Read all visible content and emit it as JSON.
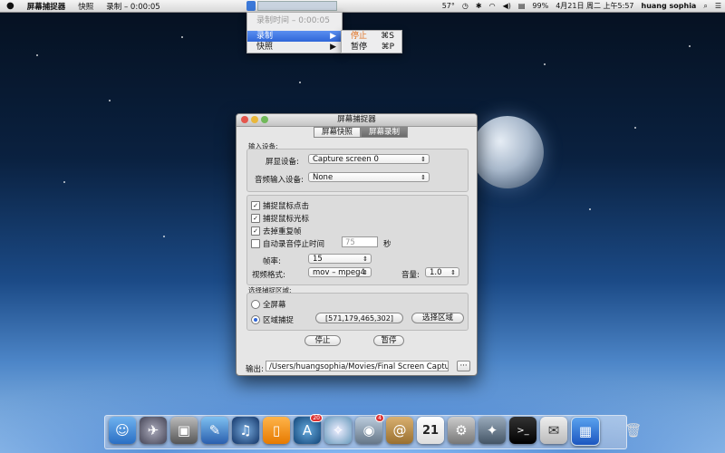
{
  "menubar": {
    "apple": "",
    "app_name": "屏幕捕捉器",
    "menu_snapshot": "快照",
    "menu_record": "录制 – 0:00:05",
    "temperature": "57°",
    "battery": "99%",
    "datetime": "4月21日 周二 上午5:57",
    "user": "huang sophia"
  },
  "status_menu": {
    "recording_time": "录制时间 – 0:00:05",
    "record": "录制",
    "snapshot": "快照"
  },
  "submenu": {
    "stop": "停止",
    "stop_shortcut": "⌘S",
    "pause": "暂停",
    "pause_shortcut": "⌘P"
  },
  "window": {
    "title": "屏幕捕捉器",
    "tab_snapshot": "屏幕快照",
    "tab_record": "屏幕录制",
    "input_group": "输入设备:",
    "display_label": "屏显设备:",
    "display_value": "Capture screen 0",
    "audio_label": "音频输入设备:",
    "audio_value": "None",
    "cb_click": "捕捉鼠标点击",
    "cb_cursor": "捕捉鼠标光标",
    "cb_dup": "去掉重复帧",
    "cb_autostop": "自动录音停止时间",
    "autostop_value": "75",
    "autostop_unit": "秒",
    "fps_label": "帧率:",
    "fps_value": "15",
    "format_label": "视频格式:",
    "format_value": "mov – mpeg4",
    "volume_label": "音量:",
    "volume_value": "1.0",
    "area_group": "选择捕捉区域:",
    "radio_full": "全屏幕",
    "radio_region": "区域捕捉",
    "region_value": "[571,179,465,302]",
    "choose_area": "选择区域",
    "stop_btn": "停止",
    "pause_btn": "暂停",
    "output_label": "输出:",
    "output_path": "/Users/huangsophia/Movies/Final Screen Capture",
    "browse": "···"
  },
  "dock": {
    "calendar_day": "21",
    "facetime_badge": "4",
    "appstore_badge": "20"
  }
}
